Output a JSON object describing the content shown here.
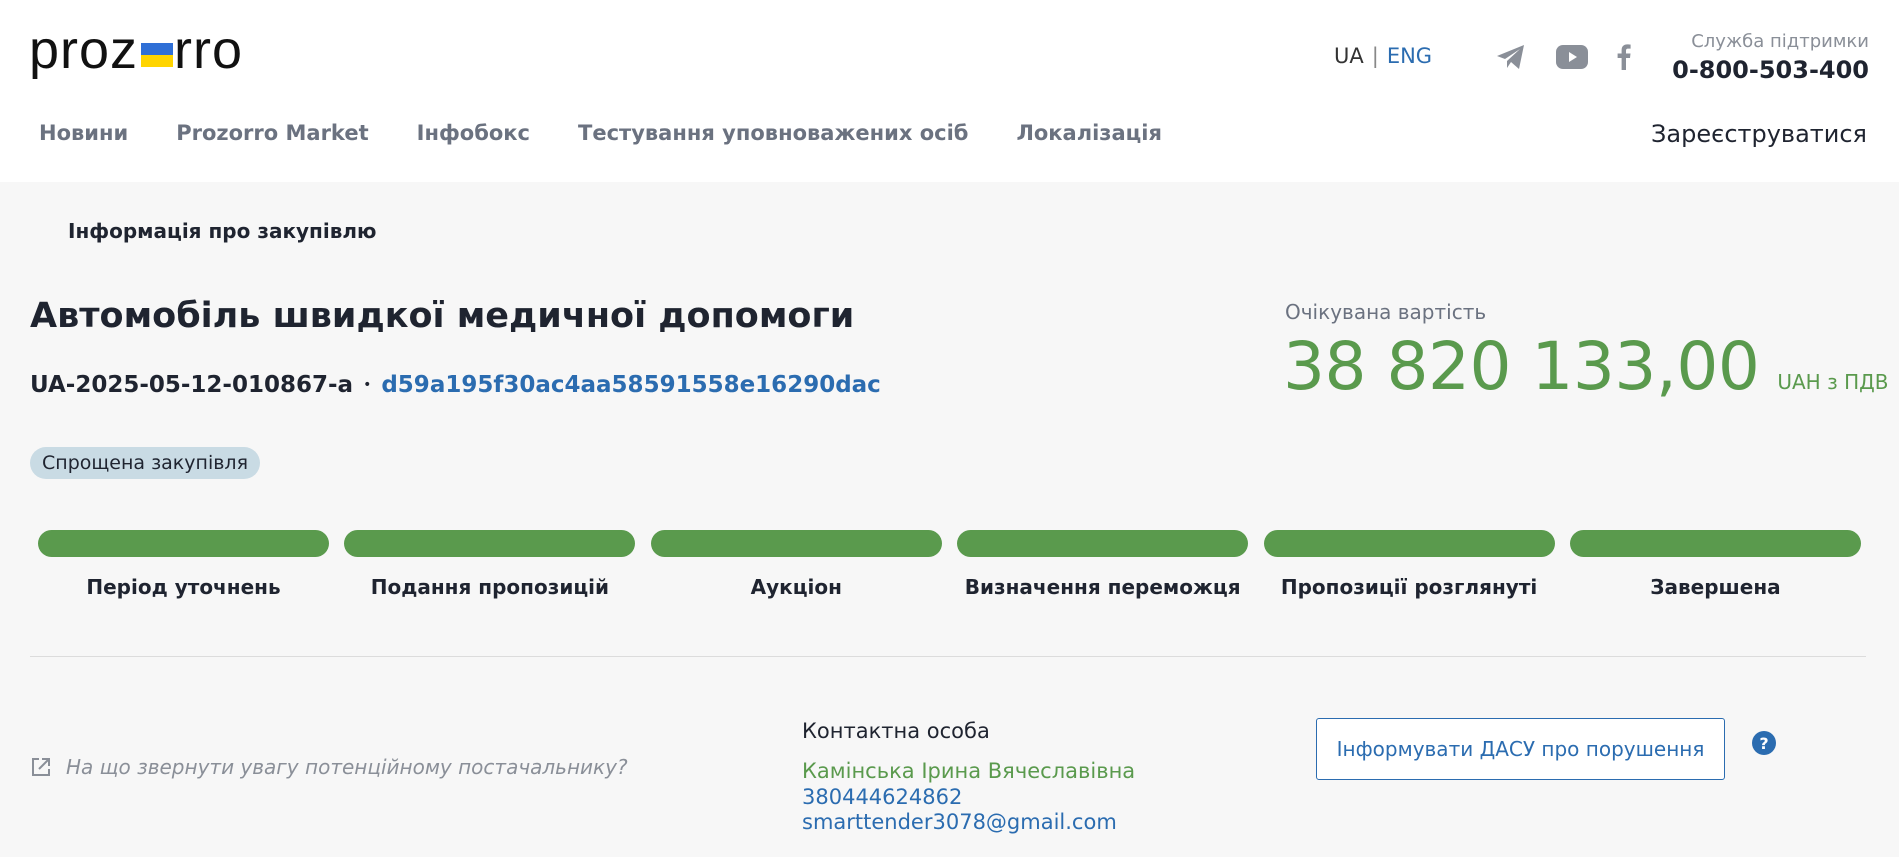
{
  "header": {
    "logo_left": "proz",
    "logo_right": "rro",
    "lang_ua": "UA",
    "lang_sep": "|",
    "lang_eng": "ENG",
    "support_label": "Служба підтримки",
    "support_phone": "0-800-503-400",
    "social": [
      "telegram-icon",
      "youtube-icon",
      "facebook-icon"
    ],
    "flag_colors": {
      "blue": "#2f6fd6",
      "yellow": "#ffd400"
    }
  },
  "nav": {
    "items": [
      "Новини",
      "Prozorro Market",
      "Інфобокс",
      "Тестування уповноважених осіб",
      "Локалізація"
    ],
    "register": "Зареєструватися"
  },
  "main": {
    "section_title": "Інформація про закупівлю",
    "tender_title": "Автомобіль швидкої медичної допомоги",
    "tender_id": "UA-2025-05-12-010867-a",
    "separator": "•",
    "tender_hash": "d59a195f30ac4aa58591558e16290dac",
    "value_label": "Очікувана вартість",
    "value": "38 820 133,00",
    "currency": "UAH з ПДВ",
    "procedure_badge": "Спрощена закупівля",
    "steps": [
      {
        "label": "Період уточнень",
        "completed": true
      },
      {
        "label": "Подання пропозицій",
        "completed": true
      },
      {
        "label": "Аукціон",
        "completed": true
      },
      {
        "label": "Визначення переможця",
        "completed": true
      },
      {
        "label": "Пропозиції розглянуті",
        "completed": true
      },
      {
        "label": "Завершена",
        "completed": true
      }
    ],
    "hint": "На що звернути увагу потенційному постачальнику?",
    "contact": {
      "label": "Контактна особа",
      "name": "Камінська Ірина Вячеславівна",
      "phone": "380444624862",
      "email": "smarttender3078@gmail.com"
    },
    "dasu_button": "Інформувати ДАСУ про порушення",
    "help": "?"
  },
  "colors": {
    "accent_blue": "#2b6cb0",
    "success_green": "#5a9a4d",
    "badge_bg": "#c9dbe4"
  }
}
